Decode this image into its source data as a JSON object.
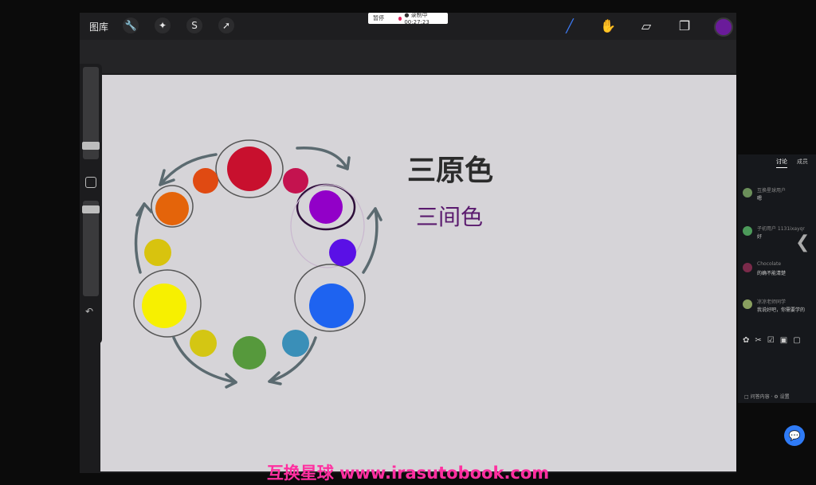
{
  "app": {
    "gallery_label": "图库",
    "tools_left": [
      {
        "icon": "wrench-icon",
        "glyph": "🔧"
      },
      {
        "icon": "magic-wand-icon",
        "glyph": "✦"
      },
      {
        "icon": "selection-icon",
        "glyph": "S"
      },
      {
        "icon": "move-arrow-icon",
        "glyph": "➚"
      }
    ],
    "tools_right": [
      {
        "icon": "brush-icon",
        "glyph": "╱"
      },
      {
        "icon": "smudge-icon",
        "glyph": "✋"
      },
      {
        "icon": "eraser-icon",
        "glyph": "▱"
      },
      {
        "icon": "layers-icon",
        "glyph": "❐"
      }
    ],
    "current_color": "#6a1b9a"
  },
  "recording": {
    "left_label": "暂停",
    "text": "● 录制中 00:27:23"
  },
  "canvas": {
    "title_text": "三原色",
    "subtitle_text": "三间色",
    "title_color": "#2b2b2b",
    "subtitle_color": "#5a1a6e"
  },
  "color_wheel": [
    {
      "name": "red",
      "color": "#c8102e"
    },
    {
      "name": "red-purple",
      "color": "#c4134f"
    },
    {
      "name": "purple",
      "color": "#9200c8"
    },
    {
      "name": "blue-purple",
      "color": "#5a10e6"
    },
    {
      "name": "blue",
      "color": "#1e63f0"
    },
    {
      "name": "blue-green",
      "color": "#3a8fb8"
    },
    {
      "name": "green",
      "color": "#56993c"
    },
    {
      "name": "yellow-green",
      "color": "#d4c613"
    },
    {
      "name": "yellow",
      "color": "#f7f000"
    },
    {
      "name": "yellow-orange",
      "color": "#d8c30e"
    },
    {
      "name": "orange",
      "color": "#e4640a"
    },
    {
      "name": "red-orange",
      "color": "#e04a12"
    }
  ],
  "chat": {
    "tabs": [
      "讨论",
      "成员"
    ],
    "messages": [
      {
        "user": "互换星球用户",
        "text": "嗯"
      },
      {
        "user": "子初用户 1131ixayqr",
        "text": "好"
      },
      {
        "user": "Chocolate",
        "text": "的确不能清楚"
      },
      {
        "user": "凉凉老师同学",
        "text": "我说好吧，你需要学的"
      }
    ],
    "footer_text": "□ 问答内容 · ⚙ 设置"
  },
  "watermark": "互换星球 www.irasutobook.com"
}
